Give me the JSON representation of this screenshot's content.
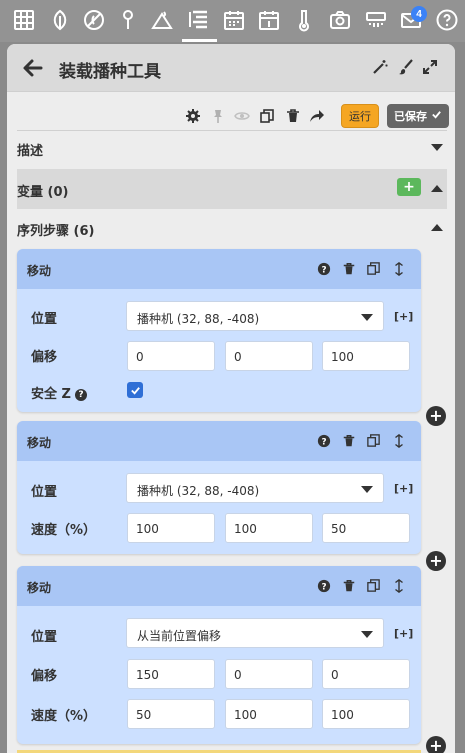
{
  "topnav": {
    "icons": [
      "crop-grid-icon",
      "seedling-icon",
      "weed-icon",
      "tool-pin-icon",
      "plant-water-icon",
      "sequence-list-icon",
      "calendar-icon",
      "calendar-day-icon",
      "thermometer-icon",
      "camera-icon",
      "spray-icon",
      "envelope-icon",
      "help-icon"
    ],
    "active": "sequence-list-icon",
    "notification_count": "4"
  },
  "panel": {
    "title": "装载播种工具",
    "toolbar": {
      "run_label": "运行",
      "saved_label": "已保存"
    }
  },
  "sections": {
    "description": "描述",
    "variables": "变量 (0)",
    "steps": "序列步骤 (6)"
  },
  "steps": [
    {
      "title": "移动",
      "location_label": "位置",
      "location_value": "播种机 (32, 88, -408)",
      "bracket_plus": "[+]",
      "offset_label": "偏移",
      "offset": [
        "0",
        "0",
        "100"
      ],
      "safe_z_label": "安全 Z",
      "safe_z_checked": true
    },
    {
      "title": "移动",
      "location_label": "位置",
      "location_value": "播种机 (32, 88, -408)",
      "bracket_plus": "[+]",
      "speed_label": "速度（%）",
      "speed": [
        "100",
        "100",
        "50"
      ]
    },
    {
      "title": "移动",
      "location_label": "位置",
      "location_value": "从当前位置偏移",
      "bracket_plus": "[+]",
      "offset_label": "偏移",
      "offset": [
        "150",
        "0",
        "0"
      ],
      "speed_label": "速度（%）",
      "speed": [
        "50",
        "100",
        "100"
      ]
    }
  ],
  "colors": {
    "step_body": "#cce0ff",
    "step_header": "#a9c6f5",
    "run_button": "#f5a623",
    "add_green": "#5cb85c",
    "badge_blue": "#3b82f6"
  }
}
